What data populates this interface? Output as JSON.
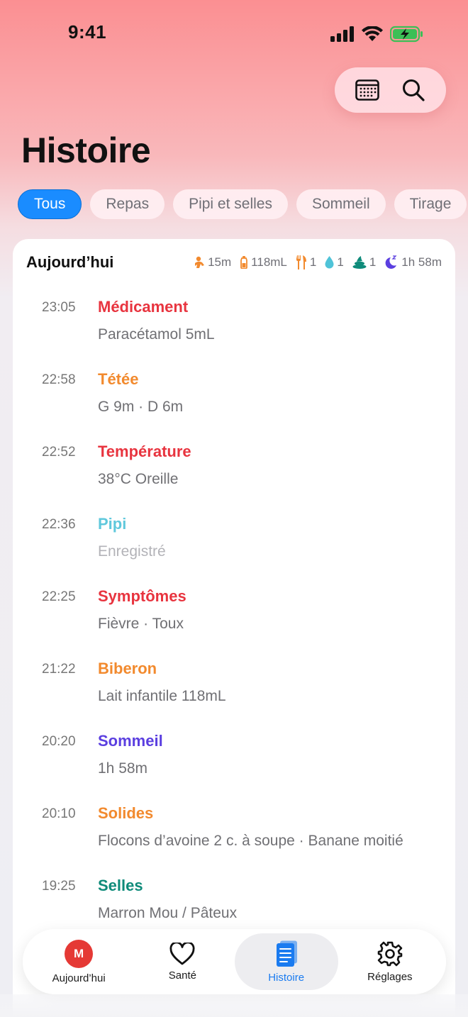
{
  "status": {
    "time": "9:41"
  },
  "colors": {
    "accent": "#1a8cff",
    "red": "#e8343f",
    "orange": "#f28a2e",
    "teal": "#4fc3d8",
    "purple": "#5b3fe0",
    "green": "#0f8b7a"
  },
  "header": {
    "title": "Histoire"
  },
  "filters": [
    "Tous",
    "Repas",
    "Pipi et selles",
    "Sommeil",
    "Tirage"
  ],
  "day": {
    "label": "Aujourd’hui",
    "summary": {
      "nursing": "15m",
      "bottle": "118mL",
      "solids": "1",
      "pee": "1",
      "poop": "1",
      "sleep": "1h 58m"
    }
  },
  "entries": [
    {
      "time": "23:05",
      "title": "Médicament",
      "detail": "Paracétamol 5mL",
      "color": "#e8343f"
    },
    {
      "time": "22:58",
      "title": "Tétée",
      "detail": "G 9m · D 6m",
      "color": "#f28a2e"
    },
    {
      "time": "22:52",
      "title": "Température",
      "detail": "38°C Oreille",
      "color": "#e8343f"
    },
    {
      "time": "22:36",
      "title": "Pipi",
      "detail": "Enregistré",
      "color": "#5fc8dc",
      "muted": true
    },
    {
      "time": "22:25",
      "title": "Symptômes",
      "detail": "Fièvre · Toux",
      "color": "#e8343f"
    },
    {
      "time": "21:22",
      "title": "Biberon",
      "detail": "Lait infantile 118mL",
      "color": "#f28a2e"
    },
    {
      "time": "20:20",
      "title": "Sommeil",
      "detail": "1h 58m",
      "color": "#5b3fe0"
    },
    {
      "time": "20:10",
      "title": "Solides",
      "detail": "Flocons d’avoine 2 c. à soupe · Banane moitié",
      "color": "#f28a2e"
    },
    {
      "time": "19:25",
      "title": "Selles",
      "detail": "Marron Mou / Pâteux",
      "color": "#0f8b7a"
    }
  ],
  "tabs": [
    {
      "label": "Aujourd’hui",
      "avatar": "M"
    },
    {
      "label": "Santé"
    },
    {
      "label": "Histoire"
    },
    {
      "label": "Réglages"
    }
  ]
}
